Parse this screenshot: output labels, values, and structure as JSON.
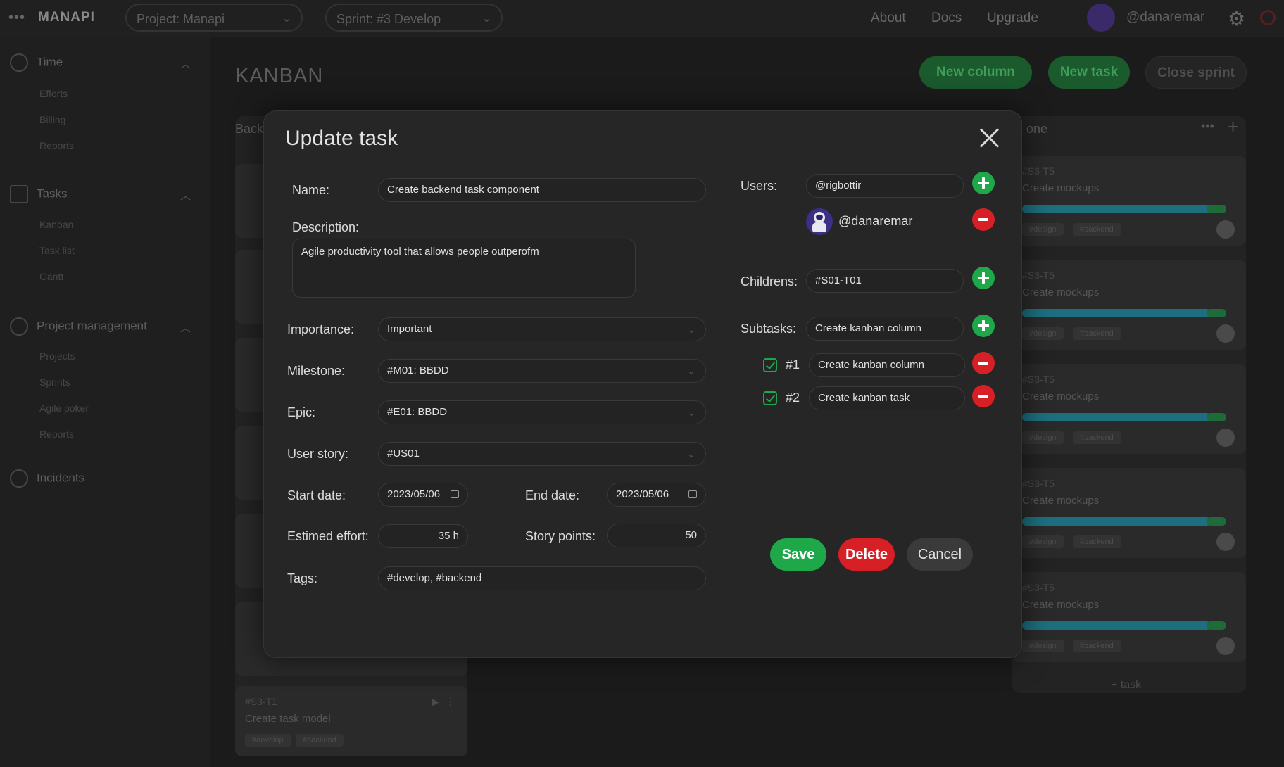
{
  "topbar": {
    "brand": "MANAPI",
    "project_select": "Project: Manapi",
    "sprint_select": "Sprint: #3 Develop",
    "links": [
      "About",
      "Docs",
      "Upgrade"
    ],
    "username": "@danaremar"
  },
  "sidebar": {
    "sections": [
      {
        "label": "Time",
        "items": [
          "Efforts",
          "Billing",
          "Reports"
        ]
      },
      {
        "label": "Tasks",
        "items": [
          "Kanban",
          "Task list",
          "Gantt"
        ]
      },
      {
        "label": "Project management",
        "items": [
          "Projects",
          "Sprints",
          "Agile poker",
          "Reports"
        ]
      },
      {
        "label": "Incidents",
        "items": []
      }
    ]
  },
  "main": {
    "title": "KANBAN",
    "buttons": {
      "new_column": "New column",
      "new_task": "New task",
      "close_sprint": "Close sprint"
    },
    "columns": {
      "left_header": "Back",
      "right_header": "one",
      "add_task": "+ task"
    },
    "bottom_card": {
      "id": "#S3-T1",
      "name": "Create task model",
      "tags": [
        "#develop",
        "#backend"
      ]
    },
    "right_cards": {
      "id": "#S3-T5",
      "name": "Create mockups",
      "tags": [
        "#design",
        "#backend"
      ]
    }
  },
  "modal": {
    "title": "Update task",
    "labels": {
      "name": "Name:",
      "description": "Description:",
      "importance": "Importance:",
      "milestone": "Milestone:",
      "epic": "Epic:",
      "user_story": "User story:",
      "start_date": "Start date:",
      "end_date": "End date:",
      "estimated_effort": "Estimed effort:",
      "story_points": "Story points:",
      "tags": "Tags:",
      "users": "Users:",
      "childrens": "Childrens:",
      "subtasks": "Subtasks:"
    },
    "values": {
      "name": "Create backend task component",
      "description": "Agile productivity tool that allows people outperofm",
      "importance": "Important",
      "milestone": "#M01: BBDD",
      "epic": "#E01: BBDD",
      "user_story": "#US01",
      "start_date": "2023/05/06",
      "end_date": "2023/05/06",
      "estimated_effort": "35 h",
      "story_points": "50",
      "tags": "#develop, #backend",
      "users_input": "@rigbottir",
      "assigned_user": "@danaremar",
      "childrens_input": "#S01-T01",
      "subtasks_input": "Create kanban column"
    },
    "subtasks": [
      {
        "num": "#1",
        "name": "Create kanban column",
        "checked": true
      },
      {
        "num": "#2",
        "name": "Create kanban task",
        "checked": true
      }
    ],
    "actions": {
      "save": "Save",
      "delete": "Delete",
      "cancel": "Cancel"
    },
    "colors": {
      "add": "#1fa84a",
      "remove": "#d71f26",
      "save": "#1fa84a",
      "delete": "#d71f26"
    }
  }
}
